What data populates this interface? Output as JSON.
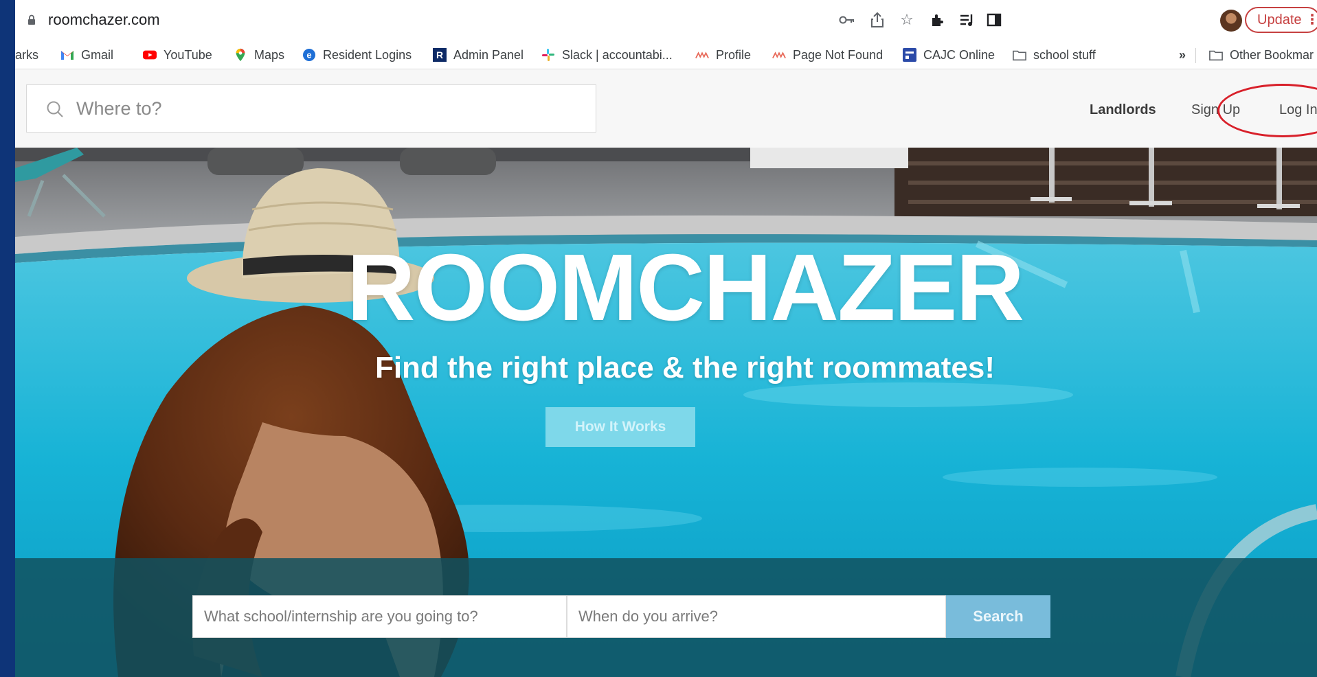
{
  "browser": {
    "url": "roomchazer.com",
    "update_label": "Update"
  },
  "bookmarks": {
    "partial_label": "arks",
    "items": [
      {
        "label": "Gmail",
        "icon": "gmail-icon"
      },
      {
        "label": "YouTube",
        "icon": "youtube-icon"
      },
      {
        "label": "Maps",
        "icon": "maps-icon"
      },
      {
        "label": "Resident Logins",
        "icon": "resident-logins-icon"
      },
      {
        "label": "Admin Panel",
        "icon": "admin-panel-icon"
      },
      {
        "label": "Slack | accountabi...",
        "icon": "slack-icon"
      },
      {
        "label": "Profile",
        "icon": "profile-icon"
      },
      {
        "label": "Page Not Found",
        "icon": "page-not-found-icon"
      },
      {
        "label": "CAJC Online",
        "icon": "cajc-online-icon"
      },
      {
        "label": "school stuff",
        "icon": "folder-icon"
      }
    ],
    "overflow": "»",
    "other": "Other Bookmar"
  },
  "header": {
    "search_placeholder": "Where to?",
    "nav": {
      "landlords": "Landlords",
      "signup": "Sign Up",
      "login": "Log In"
    }
  },
  "hero": {
    "title": "ROOMCHAZER",
    "subtitle": "Find the right place & the right roommates!",
    "cta": "How It Works"
  },
  "search": {
    "school_placeholder": "What school/internship are you going to?",
    "date_placeholder": "When do you arrive?",
    "button": "Search"
  },
  "colors": {
    "accent": "#79bcdb",
    "annotation": "#d8202a",
    "update": "#c64040"
  }
}
